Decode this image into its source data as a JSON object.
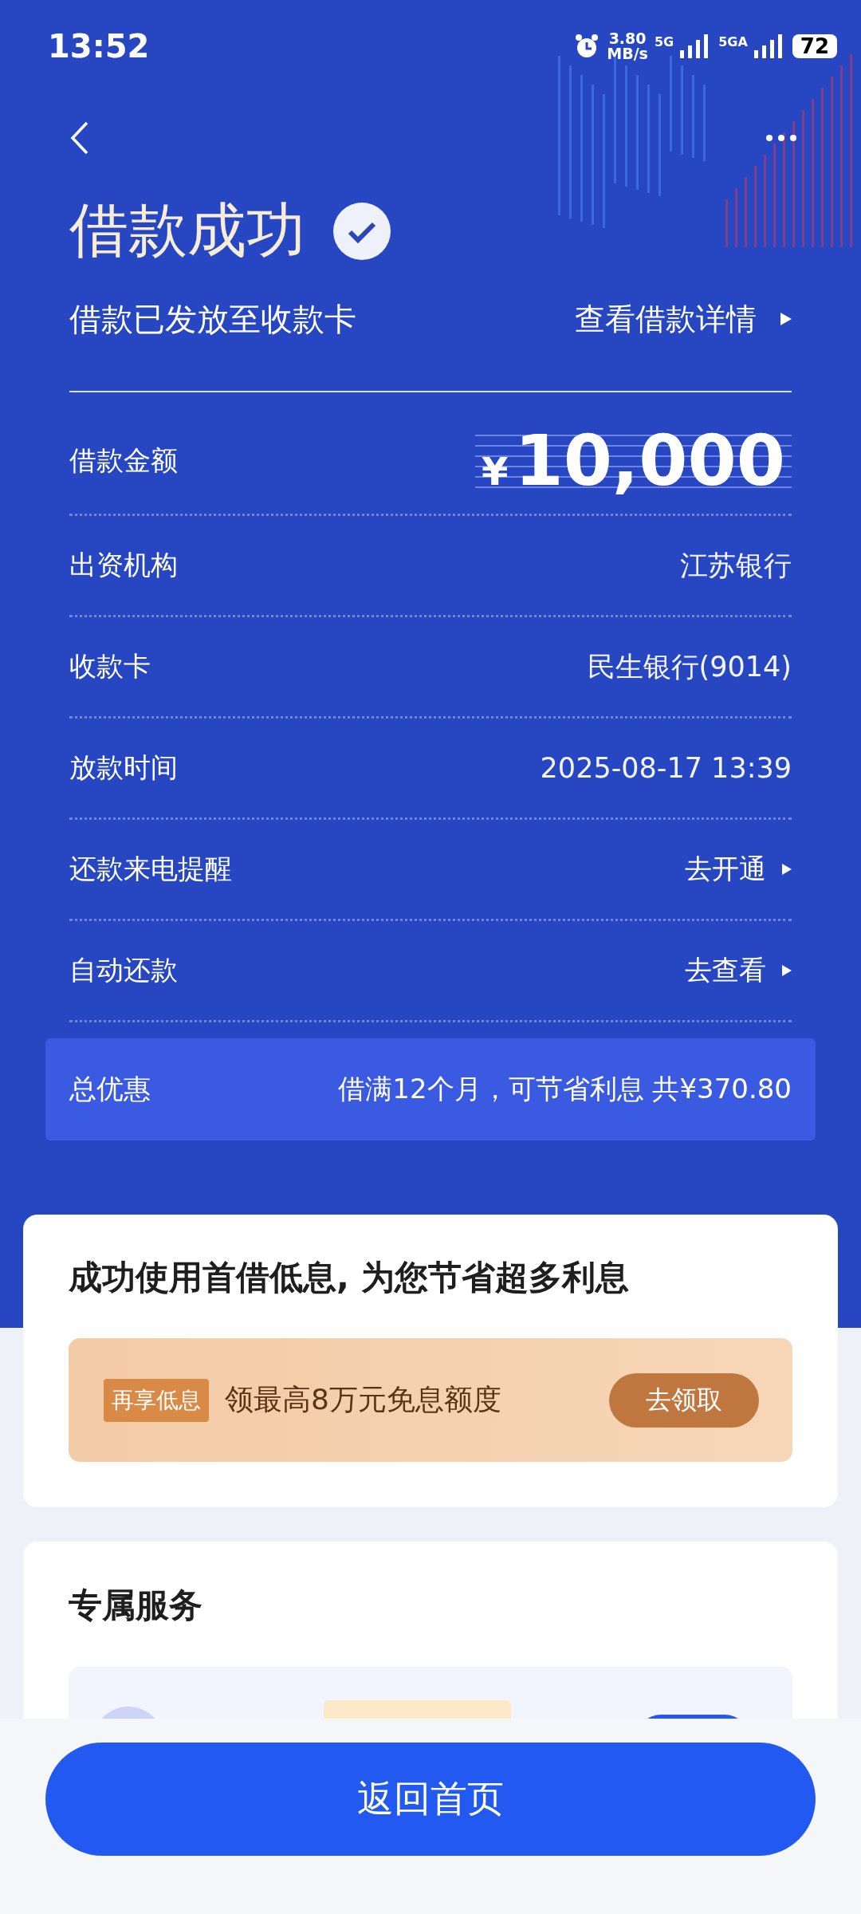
{
  "status_bar": {
    "time": "13:52",
    "speed": "3.80",
    "speed_unit": "MB/s",
    "net1": "5G",
    "net2": "5GA",
    "battery": "72"
  },
  "header": {
    "title": "借款成功",
    "subtitle": "借款已发放至收款卡",
    "detail_link": "查看借款详情"
  },
  "amount": {
    "label": "借款金额",
    "currency": "¥",
    "value": "10,000"
  },
  "rows": [
    {
      "label": "出资机构",
      "value": "江苏银行",
      "kind": "text"
    },
    {
      "label": "收款卡",
      "value": "民生银行(9014)",
      "kind": "text"
    },
    {
      "label": "放款时间",
      "value": "2025-08-17 13:39",
      "kind": "text"
    },
    {
      "label": "还款来电提醒",
      "value": "去开通",
      "kind": "link"
    },
    {
      "label": "自动还款",
      "value": "去查看",
      "kind": "link"
    }
  ],
  "discount": {
    "label": "总优惠",
    "value": "借满12个月，可节省利息 共¥370.80"
  },
  "promo_card": {
    "title": "成功使用首借低息, 为您节省超多利息",
    "tag": "再享低息",
    "text": "领最高8万元免息额度",
    "button": "去领取"
  },
  "service_card": {
    "title": "专属服务"
  },
  "bottom_button": "返回首页"
}
